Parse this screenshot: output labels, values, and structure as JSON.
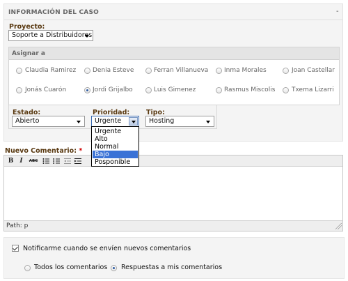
{
  "panel": {
    "title": "INFORMACIÓN DEL CASO",
    "collapse_symbol": "-"
  },
  "project": {
    "label": "Proyecto:",
    "selected": "Soporte a Distribuidores"
  },
  "assign": {
    "title": "Asignar a",
    "people": [
      {
        "name": "Claudia Ramirez",
        "selected": false
      },
      {
        "name": "Denia Esteve",
        "selected": false
      },
      {
        "name": "Ferran Villanueva",
        "selected": false
      },
      {
        "name": "Inma Morales",
        "selected": false
      },
      {
        "name": "Joan Castellar",
        "selected": false
      },
      {
        "name": "Jonás Cuarón",
        "selected": false
      },
      {
        "name": "Jordi Grijalbo",
        "selected": true
      },
      {
        "name": "Luis Gimenez",
        "selected": false
      },
      {
        "name": "Rasmus Miscolis",
        "selected": false
      },
      {
        "name": "Txema Lizarri",
        "selected": false
      }
    ]
  },
  "status": {
    "estado_label": "Estado:",
    "estado_value": "Abierto",
    "prioridad_label": "Prioridad:",
    "prioridad_value": "Urgente",
    "tipo_label": "Tipo:",
    "tipo_value": "Hosting"
  },
  "priority_options": [
    {
      "label": "Urgente",
      "highlighted": false
    },
    {
      "label": "Alto",
      "highlighted": false
    },
    {
      "label": "Normal",
      "highlighted": false
    },
    {
      "label": "Bajo",
      "highlighted": true
    },
    {
      "label": "Posponible",
      "highlighted": false
    }
  ],
  "comment": {
    "label": "Nuevo Comentario:",
    "required_mark": "*",
    "toolbar": {
      "bold": "B",
      "italic": "I",
      "strike": "ABC"
    },
    "path": "Path: p"
  },
  "notifications": {
    "checkbox_label": "Notificarme cuando se envíen nuevos comentarios",
    "checked": true,
    "options": [
      {
        "label": "Todos los comentarios",
        "selected": false
      },
      {
        "label": "Respuestas a mis comentarios",
        "selected": true
      }
    ]
  }
}
